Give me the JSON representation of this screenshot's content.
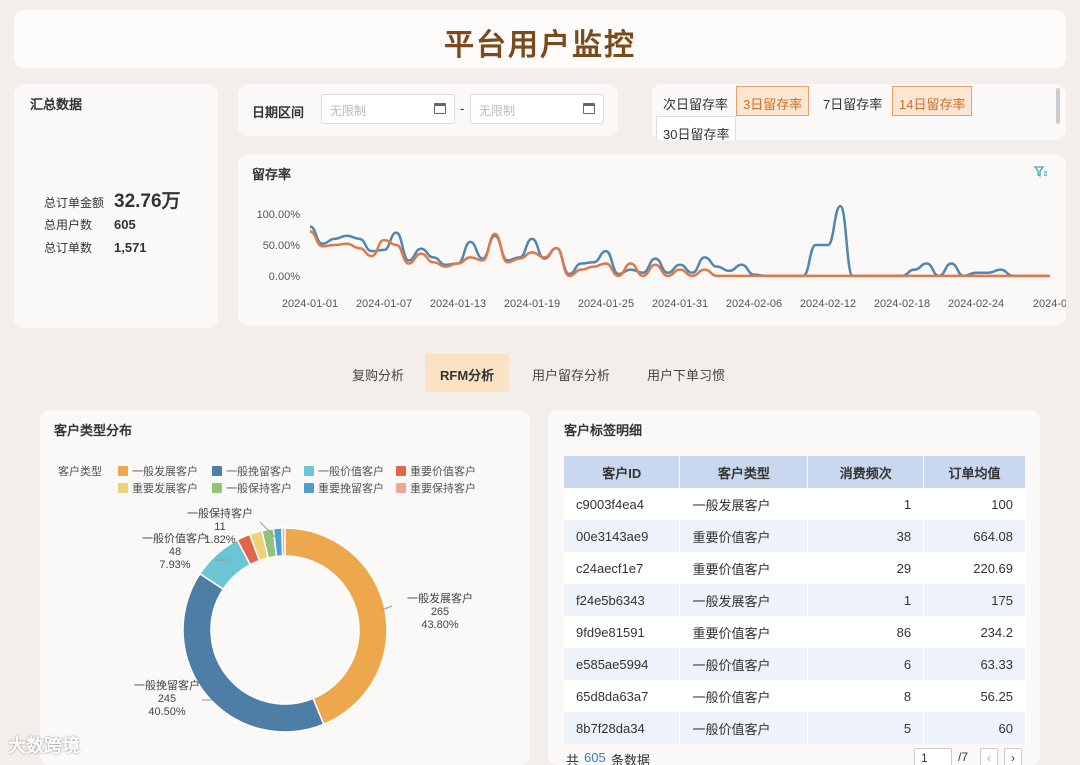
{
  "title": "平台用户监控",
  "summary": {
    "heading": "汇总数据",
    "total_amount_label": "总订单金额",
    "total_amount": "32.76万",
    "total_users_label": "总用户数",
    "total_users": "605",
    "total_orders_label": "总订单数",
    "total_orders": "1,571"
  },
  "date_range": {
    "label": "日期区间",
    "start_placeholder": "无限制",
    "separator": "-",
    "end_placeholder": "无限制"
  },
  "retention_switch": {
    "options": [
      "次日留存率",
      "3日留存率",
      "7日留存率",
      "14日留存率",
      "30日留存率"
    ],
    "active": [
      "3日留存率",
      "14日留存率"
    ]
  },
  "retention_chart": {
    "title": "留存率",
    "filter_icon": "filter-icon"
  },
  "tabs": {
    "items": [
      "复购分析",
      "RFM分析",
      "用户留存分析",
      "用户下单习惯"
    ],
    "active": "RFM分析"
  },
  "pie": {
    "title": "客户类型分布",
    "legend_title": "客户类型"
  },
  "table": {
    "title": "客户标签明细",
    "columns": [
      "客户ID",
      "客户类型",
      "消费频次",
      "订单均值"
    ],
    "rows": [
      [
        "c9003f4ea4",
        "一般发展客户",
        "1",
        "100"
      ],
      [
        "00e3143ae9",
        "重要价值客户",
        "38",
        "664.08"
      ],
      [
        "c24aecf1e7",
        "重要价值客户",
        "29",
        "220.69"
      ],
      [
        "f24e5b6343",
        "一般发展客户",
        "1",
        "175"
      ],
      [
        "9fd9e81591",
        "重要价值客户",
        "86",
        "234.2"
      ],
      [
        "e585ae5994",
        "一般价值客户",
        "6",
        "63.33"
      ],
      [
        "65d8da63a7",
        "一般价值客户",
        "8",
        "56.25"
      ],
      [
        "8b7f28da34",
        "一般价值客户",
        "5",
        "60"
      ]
    ],
    "footer_prefix": "共",
    "total": "605",
    "footer_suffix": "条数据",
    "page": "1",
    "page_total": "/7",
    "prev_icon": "chevron-left-icon",
    "next_icon": "chevron-right-icon"
  },
  "logo_text": "大数跨境",
  "chart_data": [
    {
      "type": "line",
      "title": "留存率",
      "x_ticks": [
        "2024-01-01",
        "2024-01-07",
        "2024-01-13",
        "2024-01-19",
        "2024-01-25",
        "2024-01-31",
        "2024-02-06",
        "2024-02-12",
        "2024-02-18",
        "2024-02-24",
        "2024-0"
      ],
      "y_ticks": [
        "100.00%",
        "50.00%",
        "0.00%"
      ],
      "ylim": [
        -0.1,
        1.1
      ],
      "series": [
        {
          "color": "#4e87b0",
          "values": [
            0.8,
            0.52,
            0.6,
            0.65,
            0.6,
            0.4,
            0.42,
            0.7,
            0.25,
            0.44,
            0.3,
            0.18,
            0.2,
            0.55,
            0.28,
            0.65,
            0.25,
            0.3,
            0.6,
            0.28,
            0.45,
            0.03,
            0.2,
            0.22,
            0.4,
            0.03,
            0.1,
            0.05,
            0.28,
            0.05,
            0.18,
            0.05,
            0.3,
            0.15,
            0.08,
            0.18,
            0.02,
            0.0,
            0.0,
            0.0,
            0.0,
            0.5,
            0.5,
            1.13,
            0.0,
            0.0,
            0.0,
            0.0,
            0.0,
            0.1,
            0.2,
            0.0,
            0.2,
            0.0,
            0.05,
            0.05,
            0.1,
            0.0,
            0.0,
            0.0,
            0.0
          ]
        },
        {
          "color": "#e0784a",
          "values": [
            0.72,
            0.48,
            0.5,
            0.52,
            0.45,
            0.32,
            0.58,
            0.5,
            0.2,
            0.36,
            0.22,
            0.15,
            0.2,
            0.3,
            0.25,
            0.68,
            0.22,
            0.28,
            0.38,
            0.3,
            0.45,
            0.0,
            0.1,
            0.15,
            0.2,
            0.0,
            0.2,
            0.0,
            0.18,
            0.0,
            0.1,
            0.0,
            0.1,
            0.0,
            0.0,
            0.0,
            0.0,
            0.0,
            0.0,
            0.0,
            0.0,
            0.0,
            0.0,
            0.0,
            0.0,
            0.0,
            0.0,
            0.0,
            0.0,
            0.0,
            0.0,
            0.0,
            0.0,
            0.0,
            0.0,
            0.0,
            0.0,
            0.0,
            0.0,
            0.0,
            0.0
          ]
        }
      ]
    },
    {
      "type": "pie",
      "title": "客户类型分布",
      "legend_title": "客户类型",
      "categories": [
        "一般发展客户",
        "一般挽留客户",
        "一般价值客户",
        "重要价值客户",
        "重要发展客户",
        "一般保持客户",
        "重要挽留客户",
        "重要保持客户"
      ],
      "colors": [
        "#eda84e",
        "#4e7ea6",
        "#6cc5d4",
        "#e0664a",
        "#eed27a",
        "#8ec47a",
        "#4e9ed4",
        "#f0a896"
      ],
      "values": [
        265,
        245,
        48,
        13,
        12,
        11,
        8,
        3
      ],
      "labels": [
        {
          "name": "一般发展客户",
          "count": "265",
          "pct": "43.80%"
        },
        {
          "name": "一般挽留客户",
          "count": "245",
          "pct": "40.50%"
        },
        {
          "name": "一般价值客户",
          "count": "48",
          "pct": "7.93%"
        },
        {
          "name": "一般保持客户",
          "count": "11",
          "pct": "1.82%"
        }
      ]
    }
  ]
}
